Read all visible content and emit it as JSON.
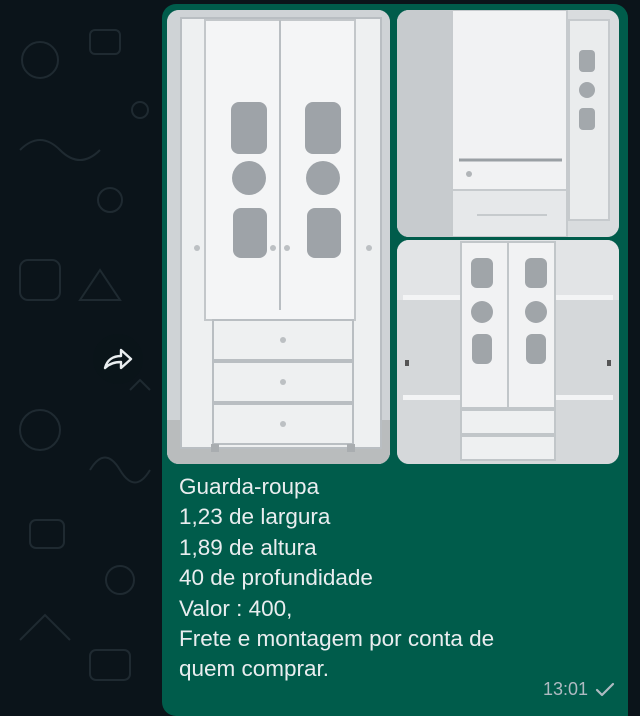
{
  "message": {
    "caption_lines": [
      "Guarda-roupa",
      "1,23 de largura",
      "1,89 de altura",
      "40 de profundidade",
      "Valor : 400,",
      "Frete e montagem por conta de",
      "quem comprar."
    ],
    "time": "13:01",
    "status_icon": "single-check-icon",
    "bubble_color": "#005c4b",
    "text_color": "#e9edef"
  },
  "photos": [
    {
      "name": "wardrobe-closed-photo"
    },
    {
      "name": "wardrobe-open-interior-photo"
    },
    {
      "name": "wardrobe-with-side-shelves-photo"
    }
  ],
  "forward_icon": "forward-icon",
  "chat_background": "#0b141a"
}
